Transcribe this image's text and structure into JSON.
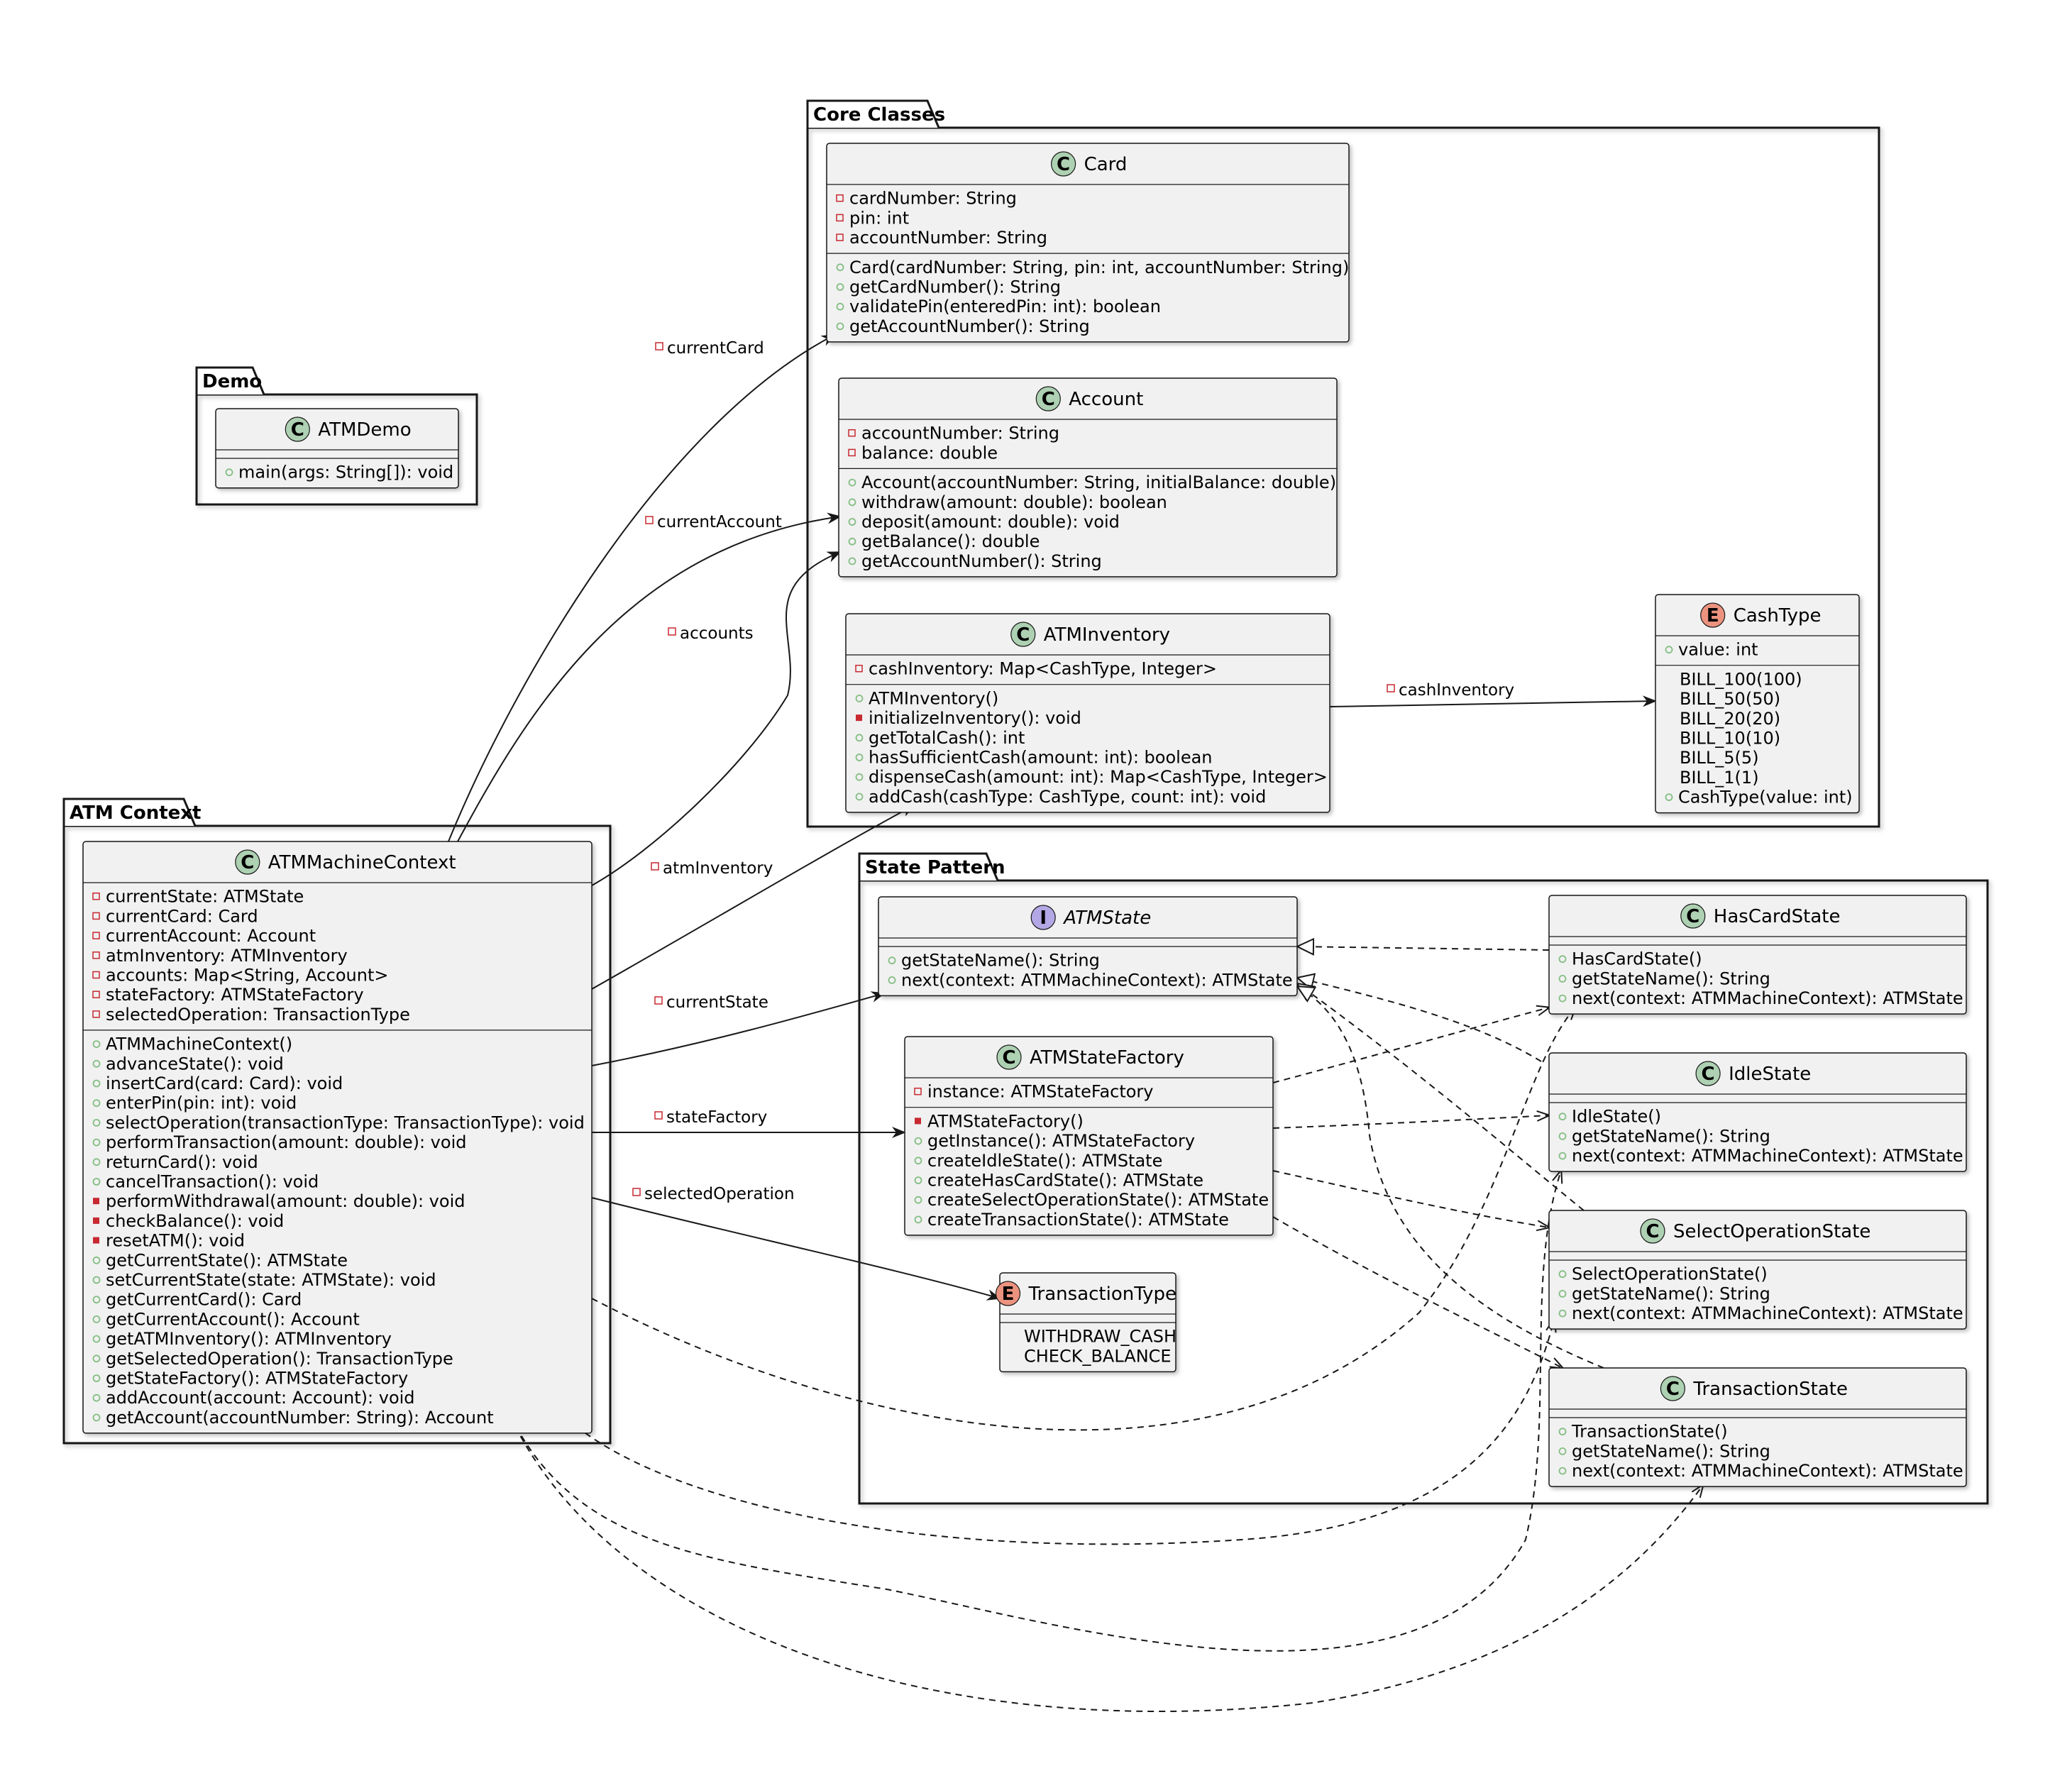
{
  "packages": [
    {
      "id": "demo",
      "label": "Demo"
    },
    {
      "id": "core",
      "label": "Core Classes"
    },
    {
      "id": "context",
      "label": "ATM Context"
    },
    {
      "id": "state",
      "label": "State Pattern"
    }
  ],
  "classes": [
    {
      "id": "ATMDemo",
      "name": "ATMDemo",
      "kind": "C",
      "attributes": [],
      "methods": [
        {
          "v": "+",
          "text": "main(args: String[]): void"
        }
      ]
    },
    {
      "id": "Card",
      "name": "Card",
      "kind": "C",
      "attributes": [
        {
          "v": "-",
          "text": "cardNumber: String"
        },
        {
          "v": "-",
          "text": "pin: int"
        },
        {
          "v": "-",
          "text": "accountNumber: String"
        }
      ],
      "methods": [
        {
          "v": "+",
          "text": "Card(cardNumber: String, pin: int, accountNumber: String)"
        },
        {
          "v": "+",
          "text": "getCardNumber(): String"
        },
        {
          "v": "+",
          "text": "validatePin(enteredPin: int): boolean"
        },
        {
          "v": "+",
          "text": "getAccountNumber(): String"
        }
      ]
    },
    {
      "id": "Account",
      "name": "Account",
      "kind": "C",
      "attributes": [
        {
          "v": "-",
          "text": "accountNumber: String"
        },
        {
          "v": "-",
          "text": "balance: double"
        }
      ],
      "methods": [
        {
          "v": "+",
          "text": "Account(accountNumber: String, initialBalance: double)"
        },
        {
          "v": "+",
          "text": "withdraw(amount: double): boolean"
        },
        {
          "v": "+",
          "text": "deposit(amount: double): void"
        },
        {
          "v": "+",
          "text": "getBalance(): double"
        },
        {
          "v": "+",
          "text": "getAccountNumber(): String"
        }
      ]
    },
    {
      "id": "ATMInventory",
      "name": "ATMInventory",
      "kind": "C",
      "attributes": [
        {
          "v": "-",
          "text": "cashInventory: Map<CashType, Integer>"
        }
      ],
      "methods": [
        {
          "v": "+",
          "text": "ATMInventory()"
        },
        {
          "v": "-m",
          "text": "initializeInventory(): void"
        },
        {
          "v": "+",
          "text": "getTotalCash(): int"
        },
        {
          "v": "+",
          "text": "hasSufficientCash(amount: int): boolean"
        },
        {
          "v": "+",
          "text": "dispenseCash(amount: int): Map<CashType, Integer>"
        },
        {
          "v": "+",
          "text": "addCash(cashType: CashType, count: int): void"
        }
      ]
    },
    {
      "id": "CashType",
      "name": "CashType",
      "kind": "E",
      "attributes": [
        {
          "v": "+",
          "text": "value: int"
        }
      ],
      "methods": [
        {
          "v": "",
          "text": "BILL_100(100)"
        },
        {
          "v": "",
          "text": "BILL_50(50)"
        },
        {
          "v": "",
          "text": "BILL_20(20)"
        },
        {
          "v": "",
          "text": "BILL_10(10)"
        },
        {
          "v": "",
          "text": "BILL_5(5)"
        },
        {
          "v": "",
          "text": "BILL_1(1)"
        },
        {
          "v": "+",
          "text": "CashType(value: int)"
        }
      ]
    },
    {
      "id": "ATMMachineContext",
      "name": "ATMMachineContext",
      "kind": "C",
      "attributes": [
        {
          "v": "-",
          "text": "currentState: ATMState"
        },
        {
          "v": "-",
          "text": "currentCard: Card"
        },
        {
          "v": "-",
          "text": "currentAccount: Account"
        },
        {
          "v": "-",
          "text": "atmInventory: ATMInventory"
        },
        {
          "v": "-",
          "text": "accounts: Map<String, Account>"
        },
        {
          "v": "-",
          "text": "stateFactory: ATMStateFactory"
        },
        {
          "v": "-",
          "text": "selectedOperation: TransactionType"
        }
      ],
      "methods": [
        {
          "v": "+",
          "text": "ATMMachineContext()"
        },
        {
          "v": "+",
          "text": "advanceState(): void"
        },
        {
          "v": "+",
          "text": "insertCard(card: Card): void"
        },
        {
          "v": "+",
          "text": "enterPin(pin: int): void"
        },
        {
          "v": "+",
          "text": "selectOperation(transactionType: TransactionType): void"
        },
        {
          "v": "+",
          "text": "performTransaction(amount: double): void"
        },
        {
          "v": "+",
          "text": "returnCard(): void"
        },
        {
          "v": "+",
          "text": "cancelTransaction(): void"
        },
        {
          "v": "-m",
          "text": "performWithdrawal(amount: double): void"
        },
        {
          "v": "-m",
          "text": "checkBalance(): void"
        },
        {
          "v": "-m",
          "text": "resetATM(): void"
        },
        {
          "v": "+",
          "text": "getCurrentState(): ATMState"
        },
        {
          "v": "+",
          "text": "setCurrentState(state: ATMState): void"
        },
        {
          "v": "+",
          "text": "getCurrentCard(): Card"
        },
        {
          "v": "+",
          "text": "getCurrentAccount(): Account"
        },
        {
          "v": "+",
          "text": "getATMInventory(): ATMInventory"
        },
        {
          "v": "+",
          "text": "getSelectedOperation(): TransactionType"
        },
        {
          "v": "+",
          "text": "getStateFactory(): ATMStateFactory"
        },
        {
          "v": "+",
          "text": "addAccount(account: Account): void"
        },
        {
          "v": "+",
          "text": "getAccount(accountNumber: String): Account"
        }
      ]
    },
    {
      "id": "ATMState",
      "name": "ATMState",
      "kind": "I",
      "attributes": [],
      "methods": [
        {
          "v": "+",
          "text": "getStateName(): String"
        },
        {
          "v": "+",
          "text": "next(context: ATMMachineContext): ATMState"
        }
      ]
    },
    {
      "id": "ATMStateFactory",
      "name": "ATMStateFactory",
      "kind": "C",
      "attributes": [
        {
          "v": "-",
          "text": "instance: ATMStateFactory"
        }
      ],
      "methods": [
        {
          "v": "-m",
          "text": "ATMStateFactory()"
        },
        {
          "v": "+",
          "text": "getInstance(): ATMStateFactory"
        },
        {
          "v": "+",
          "text": "createIdleState(): ATMState"
        },
        {
          "v": "+",
          "text": "createHasCardState(): ATMState"
        },
        {
          "v": "+",
          "text": "createSelectOperationState(): ATMState"
        },
        {
          "v": "+",
          "text": "createTransactionState(): ATMState"
        }
      ]
    },
    {
      "id": "TransactionType",
      "name": "TransactionType",
      "kind": "E",
      "attributes": [],
      "methods": [
        {
          "v": "",
          "text": "WITHDRAW_CASH"
        },
        {
          "v": "",
          "text": "CHECK_BALANCE"
        }
      ]
    },
    {
      "id": "HasCardState",
      "name": "HasCardState",
      "kind": "C",
      "attributes": [],
      "methods": [
        {
          "v": "+",
          "text": "HasCardState()"
        },
        {
          "v": "+",
          "text": "getStateName(): String"
        },
        {
          "v": "+",
          "text": "next(context: ATMMachineContext): ATMState"
        }
      ]
    },
    {
      "id": "IdleState",
      "name": "IdleState",
      "kind": "C",
      "attributes": [],
      "methods": [
        {
          "v": "+",
          "text": "IdleState()"
        },
        {
          "v": "+",
          "text": "getStateName(): String"
        },
        {
          "v": "+",
          "text": "next(context: ATMMachineContext): ATMState"
        }
      ]
    },
    {
      "id": "SelectOperationState",
      "name": "SelectOperationState",
      "kind": "C",
      "attributes": [],
      "methods": [
        {
          "v": "+",
          "text": "SelectOperationState()"
        },
        {
          "v": "+",
          "text": "getStateName(): String"
        },
        {
          "v": "+",
          "text": "next(context: ATMMachineContext): ATMState"
        }
      ]
    },
    {
      "id": "TransactionState",
      "name": "TransactionState",
      "kind": "C",
      "attributes": [],
      "methods": [
        {
          "v": "+",
          "text": "TransactionState()"
        },
        {
          "v": "+",
          "text": "getStateName(): String"
        },
        {
          "v": "+",
          "text": "next(context: ATMMachineContext): ATMState"
        }
      ]
    }
  ],
  "links": [
    {
      "id": "currentCard",
      "from": "ATMMachineContext",
      "to": "Card",
      "type": "association",
      "label": "currentCard"
    },
    {
      "id": "currentAccount",
      "from": "ATMMachineContext",
      "to": "Account",
      "type": "association",
      "label": "currentAccount"
    },
    {
      "id": "accounts",
      "from": "ATMMachineContext",
      "to": "Account",
      "type": "association",
      "label": "accounts"
    },
    {
      "id": "atmInventory",
      "from": "ATMMachineContext",
      "to": "ATMInventory",
      "type": "association",
      "label": "atmInventory"
    },
    {
      "id": "cashInventory",
      "from": "ATMInventory",
      "to": "CashType",
      "type": "association",
      "label": "cashInventory"
    },
    {
      "id": "currentState",
      "from": "ATMMachineContext",
      "to": "ATMState",
      "type": "association",
      "label": "currentState"
    },
    {
      "id": "stateFactory",
      "from": "ATMMachineContext",
      "to": "ATMStateFactory",
      "type": "association",
      "label": "stateFactory"
    },
    {
      "id": "selectedOperation",
      "from": "ATMMachineContext",
      "to": "TransactionType",
      "type": "association",
      "label": "selectedOperation"
    },
    {
      "id": "hascard-realizes",
      "from": "HasCardState",
      "to": "ATMState",
      "type": "realization",
      "label": ""
    },
    {
      "id": "idle-realizes",
      "from": "IdleState",
      "to": "ATMState",
      "type": "realization",
      "label": ""
    },
    {
      "id": "select-realizes",
      "from": "SelectOperationState",
      "to": "ATMState",
      "type": "realization",
      "label": ""
    },
    {
      "id": "transaction-realizes",
      "from": "TransactionState",
      "to": "ATMState",
      "type": "realization",
      "label": ""
    },
    {
      "id": "factory-hascard",
      "from": "ATMStateFactory",
      "to": "HasCardState",
      "type": "dependency",
      "label": ""
    },
    {
      "id": "factory-idle",
      "from": "ATMStateFactory",
      "to": "IdleState",
      "type": "dependency",
      "label": ""
    },
    {
      "id": "factory-select",
      "from": "ATMStateFactory",
      "to": "SelectOperationState",
      "type": "dependency",
      "label": ""
    },
    {
      "id": "factory-transaction",
      "from": "ATMStateFactory",
      "to": "TransactionState",
      "type": "dependency",
      "label": ""
    },
    {
      "id": "context-hascard",
      "from": "ATMMachineContext",
      "to": "HasCardState",
      "type": "dependency",
      "label": ""
    },
    {
      "id": "context-select",
      "from": "ATMMachineContext",
      "to": "SelectOperationState",
      "type": "dependency",
      "label": ""
    },
    {
      "id": "context-idle",
      "from": "ATMMachineContext",
      "to": "IdleState",
      "type": "dependency",
      "label": ""
    },
    {
      "id": "context-transaction",
      "from": "ATMMachineContext",
      "to": "TransactionState",
      "type": "dependency",
      "label": ""
    }
  ],
  "colors": {
    "box_fill": "#f1f1f1",
    "box_stroke": "#181818",
    "class_badge": "#add1b2",
    "enum_badge": "#eb937f",
    "interface_badge": "#b4a7e5",
    "private_marker": "#c82930",
    "public_marker": "#84be84",
    "line": "#181818"
  }
}
